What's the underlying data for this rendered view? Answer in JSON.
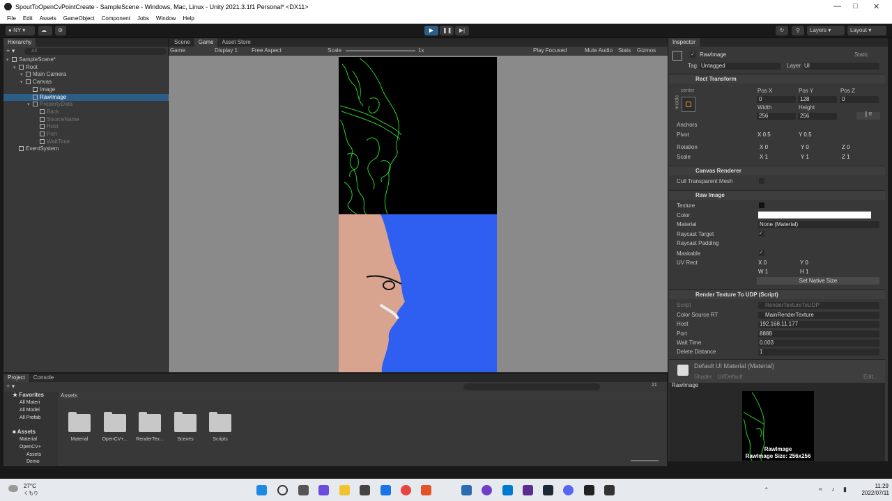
{
  "window": {
    "title": "SpoutToOpenCvPointCreate - SampleScene - Windows, Mac, Linux - Unity 2021.3.1f1 Personal* <DX11>"
  },
  "menu": [
    "File",
    "Edit",
    "Assets",
    "GameObject",
    "Component",
    "Jobs",
    "Window",
    "Help"
  ],
  "toolbar": {
    "account": "NY",
    "layers": "Layers",
    "layout": "Layout"
  },
  "hierarchy": {
    "tab": "Hierarchy",
    "search_placeholder": "All",
    "items": [
      {
        "label": "SampleScene*",
        "depth": 0,
        "selected": false,
        "dim": false
      },
      {
        "label": "Root",
        "depth": 1,
        "selected": false,
        "dim": false
      },
      {
        "label": "Main Camera",
        "depth": 2,
        "selected": false,
        "dim": false
      },
      {
        "label": "Canvas",
        "depth": 2,
        "selected": false,
        "dim": false
      },
      {
        "label": "Image",
        "depth": 3,
        "selected": false,
        "dim": false
      },
      {
        "label": "RawImage",
        "depth": 3,
        "selected": true,
        "dim": false
      },
      {
        "label": "PropertyData",
        "depth": 3,
        "selected": false,
        "dim": true
      },
      {
        "label": "Back",
        "depth": 4,
        "selected": false,
        "dim": true
      },
      {
        "label": "SourceName",
        "depth": 4,
        "selected": false,
        "dim": true
      },
      {
        "label": "Host",
        "depth": 4,
        "selected": false,
        "dim": true
      },
      {
        "label": "Port",
        "depth": 4,
        "selected": false,
        "dim": true
      },
      {
        "label": "WaitTime",
        "depth": 4,
        "selected": false,
        "dim": true
      },
      {
        "label": "EventSystem",
        "depth": 1,
        "selected": false,
        "dim": false
      }
    ]
  },
  "center": {
    "tabs": [
      "Scene",
      "Game",
      "Asset Store"
    ],
    "game_bar": {
      "mode": "Game",
      "display": "Display 1",
      "aspect": "Free Aspect",
      "scale_label": "Scale",
      "scale_value": "1x",
      "play_focused": "Play Focused",
      "mute": "Mute Audio",
      "stats": "Stats",
      "gizmos": "Gizmos"
    }
  },
  "inspector": {
    "tab": "Inspector",
    "object_name": "RawImage",
    "static_label": "Static",
    "tag_label": "Tag",
    "tag_value": "Untagged",
    "layer_label": "Layer",
    "layer_value": "UI",
    "rect_transform": {
      "title": "Rect Transform",
      "anchor_label": "center",
      "side_label": "middle",
      "posx_label": "Pos X",
      "posy_label": "Pos Y",
      "posz_label": "Pos Z",
      "posx": "0",
      "posy": "128",
      "posz": "0",
      "width_label": "Width",
      "height_label": "Height",
      "width": "256",
      "height": "256",
      "anchors": "Anchors",
      "pivot": "Pivot",
      "pivot_x": "0.5",
      "pivot_y": "0.5",
      "rotation": "Rotation",
      "rot_x": "0",
      "rot_y": "0",
      "rot_z": "0",
      "scale": "Scale",
      "scale_x": "1",
      "scale_y": "1",
      "scale_z": "1"
    },
    "canvas_renderer": {
      "title": "Canvas Renderer",
      "cull": "Cull Transparent Mesh"
    },
    "raw_image": {
      "title": "Raw Image",
      "texture": "Texture",
      "color": "Color",
      "material": "Material",
      "material_value": "None (Material)",
      "raycast_target": "Raycast Target",
      "raycast_padding": "Raycast Padding",
      "maskable": "Maskable",
      "uv_rect": "UV Rect",
      "uv_x": "0",
      "uv_y": "0",
      "uv_w": "1",
      "uv_h": "1",
      "native_button": "Set Native Size"
    },
    "script": {
      "title": "Render Texture To UDP (Script)",
      "script_label": "Script",
      "script_value": "RenderTextureToUDP",
      "color_rt_label": "Color Source RT",
      "color_rt_value": "MainRenderTexture",
      "host_label": "Host",
      "host_value": "192.168.11.177",
      "port_label": "Port",
      "port_value": "8888",
      "wait_label": "Wait Time",
      "wait_value": "0.003",
      "delete_label": "Delete Distance",
      "delete_value": "1"
    },
    "material": {
      "title": "Default UI Material (Material)",
      "shader_label": "Shader",
      "shader_value": "UI/Default",
      "edit": "Edit..."
    },
    "preview": {
      "header": "RawImage",
      "name": "RawImage",
      "size": "RawImage Size: 256x256"
    }
  },
  "project": {
    "tabs": [
      "Project",
      "Console"
    ],
    "favorites_title": "Favorites",
    "favorites": [
      "All Materi",
      "All Model",
      "All Prefab"
    ],
    "assets_title": "Assets",
    "tree": [
      "Material",
      "OpenCV+",
      "Assets",
      "Demo"
    ],
    "breadcrumb": "Assets",
    "folders": [
      "Material",
      "OpenCV+...",
      "RenderTex...",
      "Scenes",
      "Scripts"
    ],
    "count": "21"
  },
  "taskbar": {
    "temp": "27°C",
    "weather": "くもり",
    "time": "11:29",
    "date": "2022/07/11"
  },
  "colors": {
    "accent": "#2c5d87",
    "panel": "#383838",
    "dark": "#191919",
    "blue_bg": "#2f5ff0",
    "edge_green": "#27d627"
  }
}
